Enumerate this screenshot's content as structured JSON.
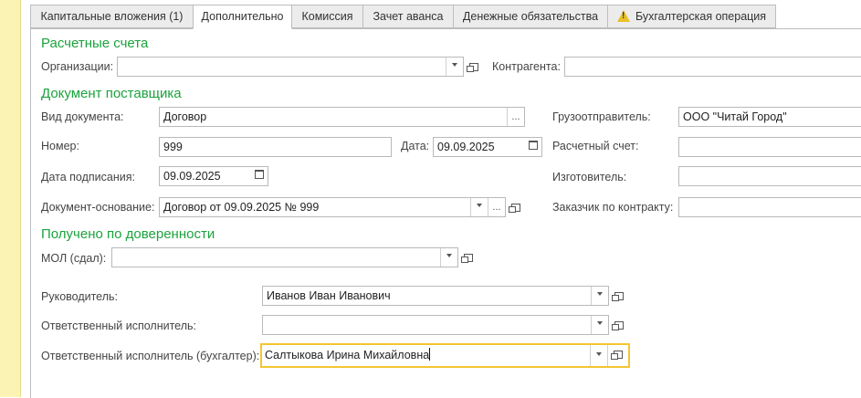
{
  "tabs": [
    {
      "label": "Капитальные вложения (1)"
    },
    {
      "label": "Дополнительно"
    },
    {
      "label": "Комиссия"
    },
    {
      "label": "Зачет аванса"
    },
    {
      "label": "Денежные обязательства"
    },
    {
      "label": "Бухгалтерская операция"
    }
  ],
  "sections": {
    "accounts": "Расчетные счета",
    "supplier_doc": "Документ поставщика",
    "proxy": "Получено по доверенности"
  },
  "accounts": {
    "org_label": "Организации:",
    "org_value": "",
    "counterparty_label": "Контрагента:",
    "counterparty_value": ""
  },
  "doc": {
    "type_label": "Вид документа:",
    "type_value": "Договор",
    "number_label": "Номер:",
    "number_value": "999",
    "date_label": "Дата:",
    "date_value": "09.09.2025",
    "sign_date_label": "Дата подписания:",
    "sign_date_value": "09.09.2025",
    "basis_label": "Документ-основание:",
    "basis_value": "Договор от 09.09.2025 № 999",
    "shipper_label": "Грузоотправитель:",
    "shipper_value": "ООО \"Читай Город\"",
    "account_label": "Расчетный счет:",
    "account_value": "",
    "maker_label": "Изготовитель:",
    "maker_value": "",
    "customer_label": "Заказчик по контракту:",
    "customer_value": ""
  },
  "proxy": {
    "mol_label": "МОЛ (сдал):",
    "mol_value": "",
    "head_label": "Руководитель:",
    "head_value": "Иванов Иван Иванович",
    "exec_label": "Ответственный исполнитель:",
    "exec_value": "",
    "acc_exec_label": "Ответственный исполнитель (бухгалтер):",
    "acc_exec_value": "Салтыкова Ирина Михайловна"
  },
  "buttons": {
    "select_label": "..."
  },
  "colors": {
    "section": "#1aa33c",
    "focus_border": "#f3c630",
    "warning": "#e8c127"
  },
  "icons": {
    "dropdown": "chevron-down-icon",
    "open": "open-form-icon",
    "calendar": "calendar-icon",
    "warning": "warning-icon"
  }
}
